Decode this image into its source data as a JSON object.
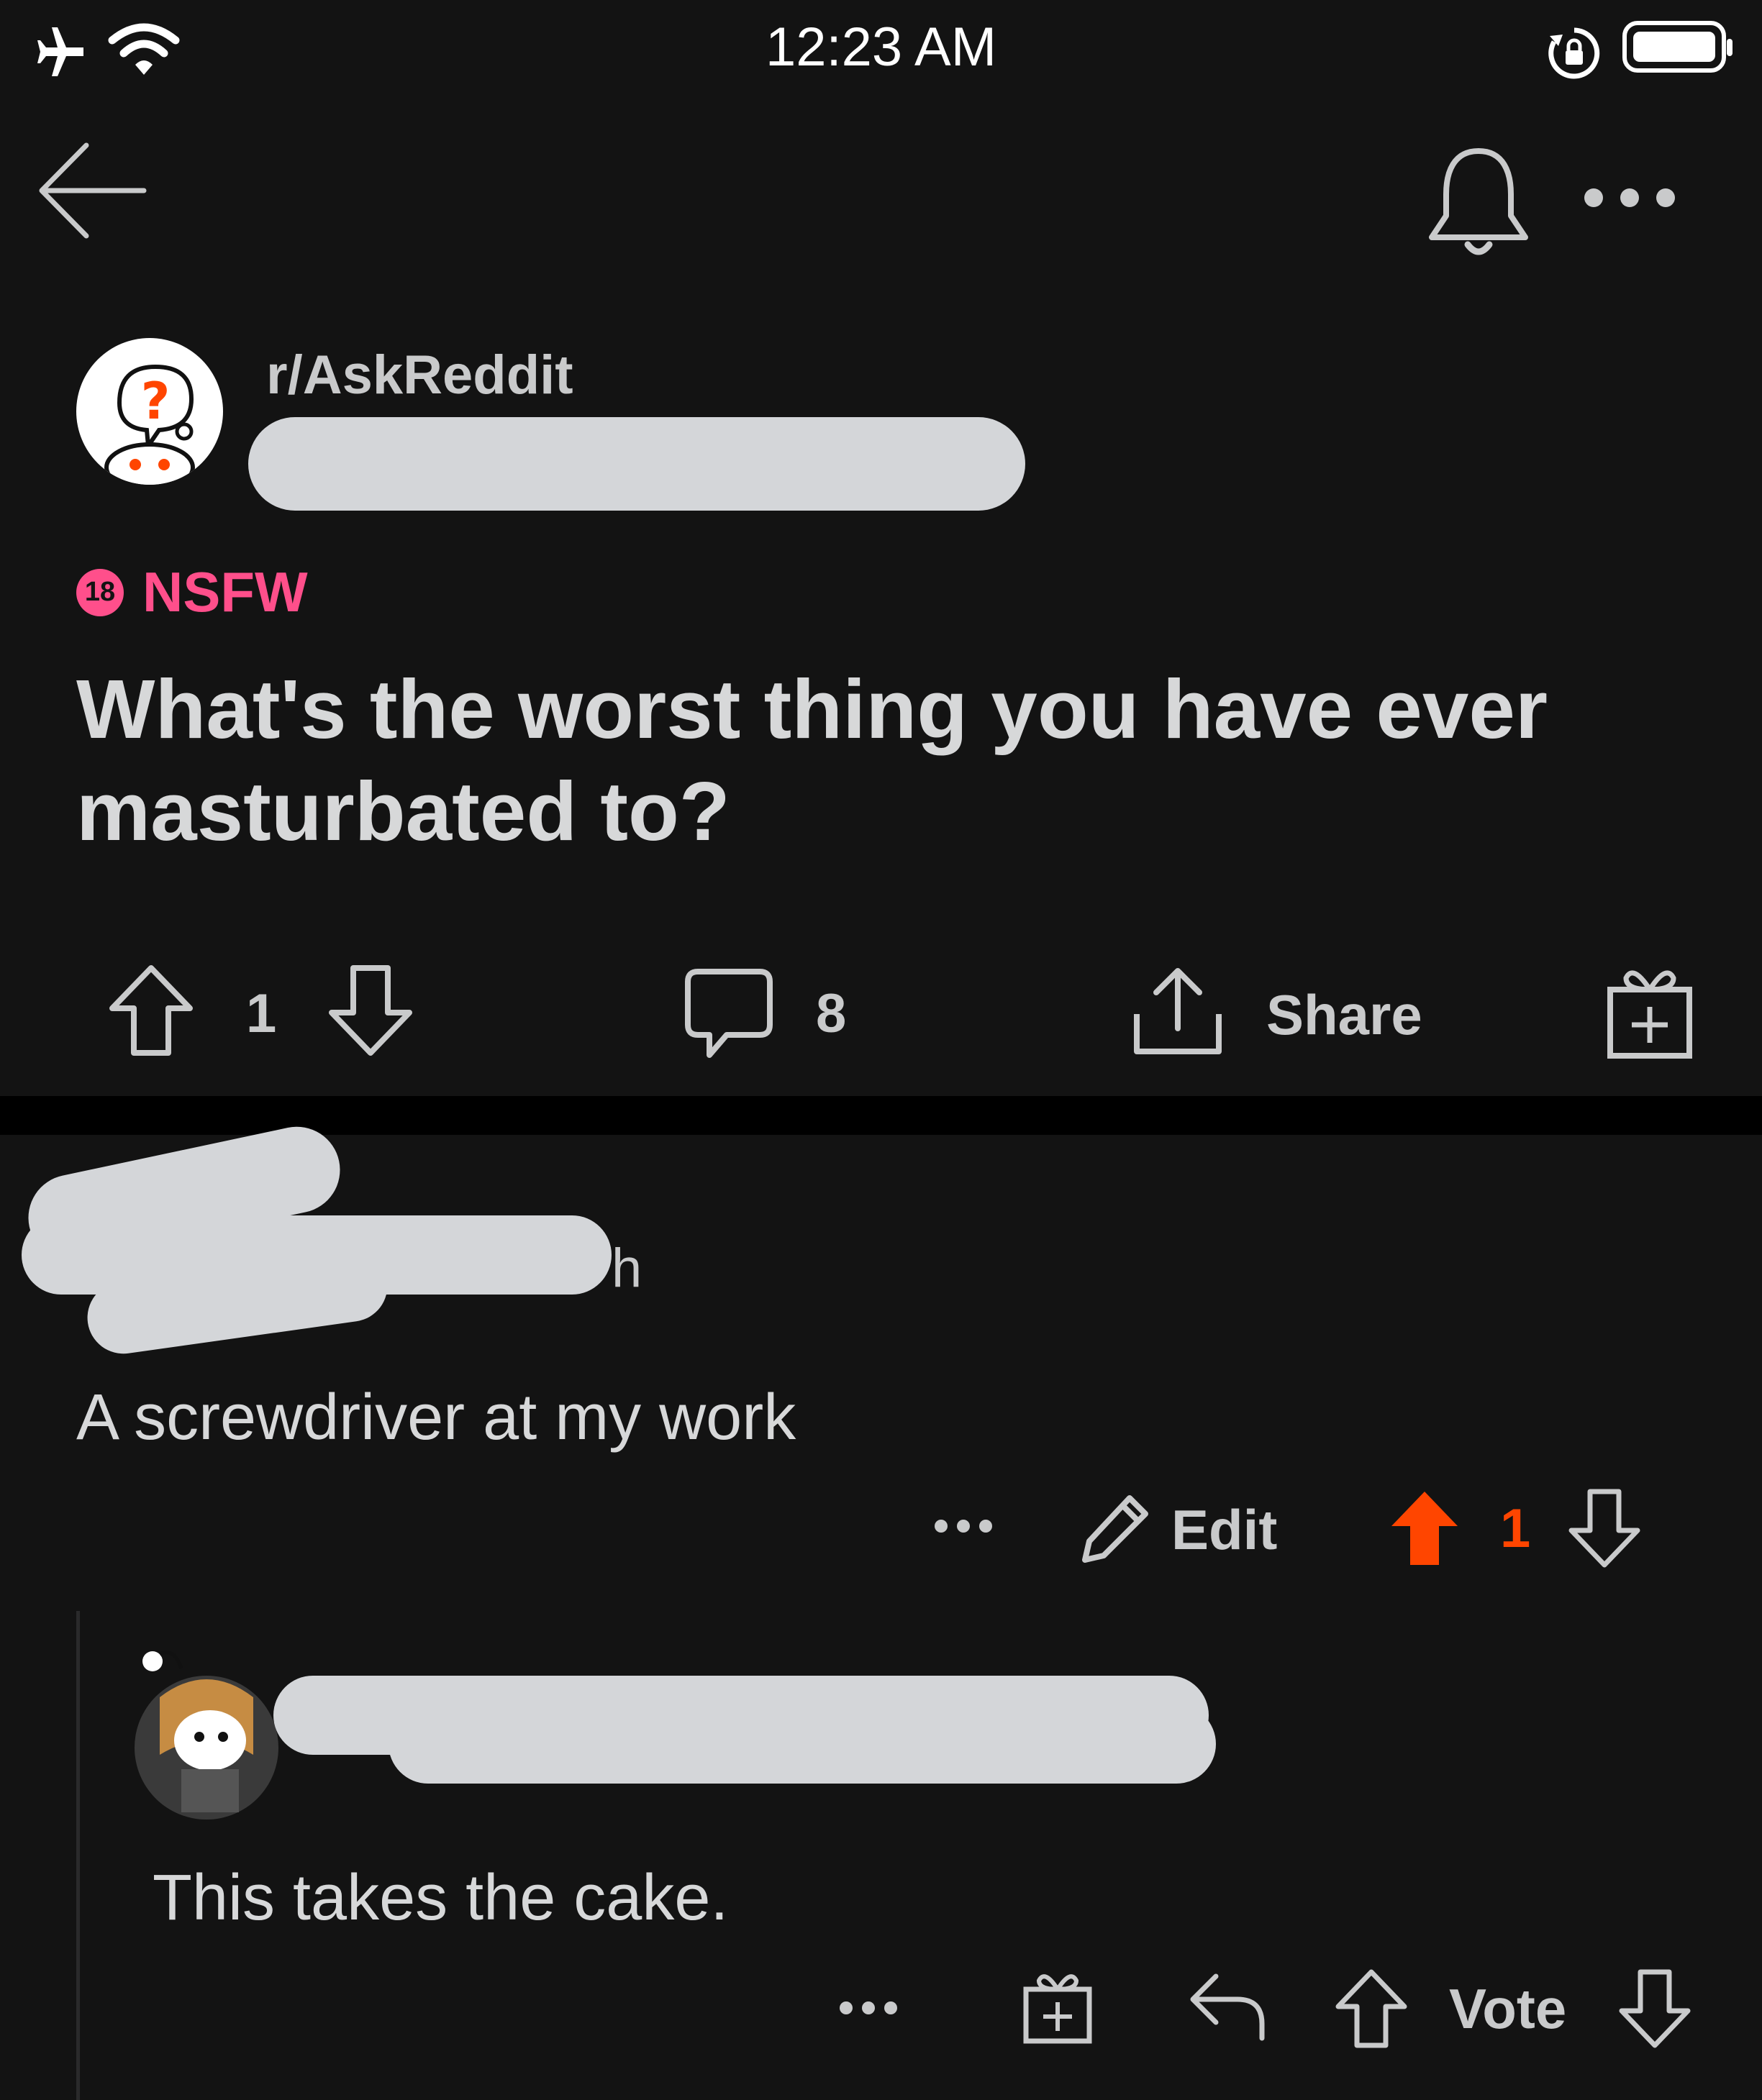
{
  "status_bar": {
    "time": "12:23 AM"
  },
  "header": {
    "back_icon": "arrow-left-icon",
    "bell_icon": "bell-icon",
    "more_icon": "more-horizontal-icon"
  },
  "post": {
    "subreddit": "r/AskReddit",
    "author_meta_redacted": true,
    "nsfw_badge": "18",
    "nsfw_label": "NSFW",
    "title": "What's the worst thing you have ever masturbated to?",
    "score": "1",
    "comments": "8",
    "share_label": "Share"
  },
  "comment": {
    "author_meta_redacted": true,
    "time_suffix": "h",
    "body": "A screwdriver at my work",
    "edit_label": "Edit",
    "score": "1",
    "upvoted_color": "#ff4500"
  },
  "reply": {
    "author_meta_redacted": true,
    "body": "This takes the cake.",
    "vote_label": "Vote"
  }
}
